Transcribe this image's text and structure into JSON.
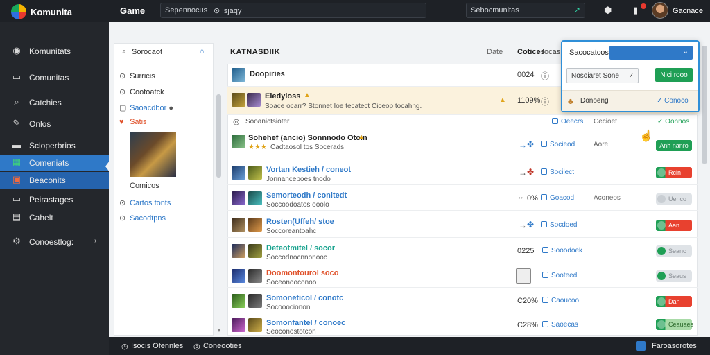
{
  "topbar": {
    "logo_text": "Komunita",
    "title": "Game",
    "search_placeholder": "Sepennocus",
    "search_filter": "⊙ isjaqy",
    "search2_placeholder": "Sebocmunitas",
    "user_name": "Gacnace"
  },
  "sidebar": {
    "items": [
      {
        "label": "Komunitats",
        "icon": "community-icon"
      },
      {
        "label": "Comunitas",
        "icon": "list-icon"
      },
      {
        "label": "Catchies",
        "icon": "search-icon"
      },
      {
        "label": "Onlos",
        "icon": "pencil-icon"
      },
      {
        "label": "Scloperbrios",
        "icon": "folder-icon"
      },
      {
        "label": "Comeniats",
        "icon": "grid-icon"
      },
      {
        "label": "Beaconits",
        "icon": "flag-icon"
      },
      {
        "label": "Peirastages",
        "icon": "chat-icon"
      },
      {
        "label": "Cahelt",
        "icon": "calendar-icon"
      },
      {
        "label": "Conoestlog:",
        "icon": "gear-icon"
      }
    ]
  },
  "filters": {
    "search_placeholder": "Sorocaot",
    "items": [
      {
        "label": "Surricis",
        "icon": "⊙"
      },
      {
        "label": "Cootoatck",
        "icon": "⊙"
      },
      {
        "label": "Saoacdbor",
        "icon": "▢"
      },
      {
        "label": "Satis",
        "icon": "♥"
      }
    ],
    "preview_label": "Comicos",
    "bottom_items": [
      {
        "label": "Cartos fonts",
        "icon": "⊙"
      },
      {
        "label": "Sacodtpns",
        "icon": "⊙"
      }
    ]
  },
  "content": {
    "title": "KATNASDIIK",
    "date_label": "Date",
    "col_label": "Cotices",
    "col2_label": "focas"
  },
  "rows": [
    {
      "name": "Doopiries",
      "sub": "",
      "pct": "0024",
      "status": "",
      "extra": ""
    },
    {
      "name": "Eledyioss",
      "sub": "Soace ocarr? Stonnet Ioe tecatect Ciceop tocahng.",
      "pct": "1109%",
      "status": "",
      "extra": ""
    },
    {
      "name": "",
      "sub": "Sooanictsioter",
      "pct": "",
      "status": "Oeecrs",
      "extra": "Cecioet"
    },
    {
      "name": "Sohehef (ancio) Sonnnodo Otoin",
      "sub": "Cadtaosol tos Socerads",
      "pct": "",
      "status": "Socieod",
      "extra": "Aore"
    },
    {
      "name": "Vortan Kestieh / coneot",
      "sub": "Jonnanceboes tnodo",
      "pct": "",
      "status": "Socilect",
      "extra": ""
    },
    {
      "name": "Semorteodh / conitedt",
      "sub": "Soccoodoatos ooolo",
      "pct": "0%",
      "status": "Goacod",
      "extra": "Aconeos"
    },
    {
      "name": "Rosten(Uffeh/ stoe",
      "sub": "Soccoreantoahc",
      "pct": "",
      "status": "Socdoed",
      "extra": ""
    },
    {
      "name": "Deteotmitel / socor",
      "sub": "Soccodnocnnonooc",
      "pct": "0225",
      "status": "Sooodoek",
      "extra": ""
    },
    {
      "name": "Doomontourol  soco",
      "sub": "Soceonooconoo",
      "pct": "",
      "status": "Sooteed",
      "extra": ""
    },
    {
      "name": "Somoneticol / conotc",
      "sub": "Socooocionon",
      "pct": "C20%",
      "status": "Caoucoo",
      "extra": ""
    },
    {
      "name": "Somonfantel / conoec",
      "sub": "Seoconostotcon",
      "pct": "C28%",
      "status": "Saoecas",
      "extra": ""
    }
  ],
  "row_buttons": {
    "add_label": "Anh nanro",
    "r4": "Rcin",
    "r5": "Uenco",
    "r6": "Aan",
    "r7": "Seanc",
    "r8": "Seaus",
    "r9": "Dan",
    "r10": "Ceauaes"
  },
  "row_green_link": "Oonnos",
  "popup": {
    "title": "Sacocatcos",
    "dropdown_value": "Nosoiaret Sone",
    "button_label": "Nici rooo",
    "footer_name": "Donoeng",
    "footer_check": "Conoco"
  },
  "bottombar": {
    "left": "Isocis Ofennles",
    "mid": "Coneooties",
    "right": "Faroasorotes"
  }
}
